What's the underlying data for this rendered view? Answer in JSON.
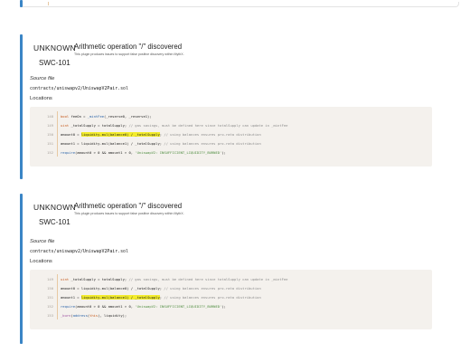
{
  "issues": [
    {
      "severity": "UNKNOWN",
      "swc_id": "SWC-101",
      "title": "Arithmetic operation \"/\" discovered",
      "description": "This plugin produces issues to support false positive discovery within MythX.",
      "source_label": "Source file",
      "source_file": "contracts/uniswapv2/UniswapV2Pair.sol",
      "locations_label": "Locations",
      "code": [
        {
          "ln": "148",
          "tokens": [
            {
              "c": "kw",
              "t": "bool"
            },
            {
              "c": "plain",
              "t": " feeOn = "
            },
            {
              "c": "fn",
              "t": "_mintFee"
            },
            {
              "c": "plain",
              "t": "(_reserve0, _reserve1);"
            }
          ]
        },
        {
          "ln": "149",
          "tokens": [
            {
              "c": "kw",
              "t": "uint"
            },
            {
              "c": "plain",
              "t": " _totalSupply = totalSupply; "
            },
            {
              "c": "cmt",
              "t": "// gas savings, must be defined here since totalSupply can update in _mintFee"
            }
          ]
        },
        {
          "ln": "150",
          "tokens": [
            {
              "c": "plain",
              "t": "amount0 = "
            },
            {
              "c": "hl",
              "t": "liquidity.mul(balance0) / _totalSupply"
            },
            {
              "c": "plain",
              "t": "; "
            },
            {
              "c": "cmt",
              "t": "// using balances ensures pro-rata distribution"
            }
          ]
        },
        {
          "ln": "151",
          "tokens": [
            {
              "c": "plain",
              "t": "amount1 = liquidity.mul(balance1) / _totalSupply; "
            },
            {
              "c": "cmt",
              "t": "// using balances ensures pro-rata distribution"
            }
          ]
        },
        {
          "ln": "152",
          "tokens": [
            {
              "c": "fn",
              "t": "require"
            },
            {
              "c": "plain",
              "t": "(amount0 > 0 && amount1 > 0, "
            },
            {
              "c": "str",
              "t": "'UniswapV2: INSUFFICIENT_LIQUIDITY_BURNED'"
            },
            {
              "c": "plain",
              "t": ");"
            }
          ]
        }
      ]
    },
    {
      "severity": "UNKNOWN",
      "swc_id": "SWC-101",
      "title": "Arithmetic operation \"/\" discovered",
      "description": "This plugin produces issues to support false positive discovery within MythX.",
      "source_label": "Source file",
      "source_file": "contracts/uniswapv2/UniswapV2Pair.sol",
      "locations_label": "Locations",
      "code": [
        {
          "ln": "149",
          "tokens": [
            {
              "c": "kw",
              "t": "uint"
            },
            {
              "c": "plain",
              "t": " _totalSupply = totalSupply; "
            },
            {
              "c": "cmt",
              "t": "// gas savings, must be defined here since totalSupply can update in _mintFee"
            }
          ]
        },
        {
          "ln": "150",
          "tokens": [
            {
              "c": "plain",
              "t": "amount0 = liquidity.mul(balance0) / _totalSupply; "
            },
            {
              "c": "cmt",
              "t": "// using balances ensures pro-rata distribution"
            }
          ]
        },
        {
          "ln": "151",
          "tokens": [
            {
              "c": "plain",
              "t": "amount1 = "
            },
            {
              "c": "hl",
              "t": "liquidity.mul(balance1) / _totalSupply"
            },
            {
              "c": "plain",
              "t": "; "
            },
            {
              "c": "cmt",
              "t": "// using balances ensures pro-rata distribution"
            }
          ]
        },
        {
          "ln": "152",
          "tokens": [
            {
              "c": "fn",
              "t": "require"
            },
            {
              "c": "plain",
              "t": "(amount0 > 0 && amount1 > 0, "
            },
            {
              "c": "str",
              "t": "'UniswapV2: INSUFFICIENT_LIQUIDITY_BURNED'"
            },
            {
              "c": "plain",
              "t": ");"
            }
          ]
        },
        {
          "ln": "153",
          "tokens": [
            {
              "c": "var",
              "t": "_burn"
            },
            {
              "c": "plain",
              "t": "("
            },
            {
              "c": "fn",
              "t": "address"
            },
            {
              "c": "plain",
              "t": "("
            },
            {
              "c": "kw",
              "t": "this"
            },
            {
              "c": "plain",
              "t": "), liquidity);"
            }
          ]
        }
      ]
    }
  ],
  "colors": {
    "accent_bar": "#3a85c6",
    "code_bg": "#f4f1ed",
    "highlight": "#f3ec2c"
  }
}
